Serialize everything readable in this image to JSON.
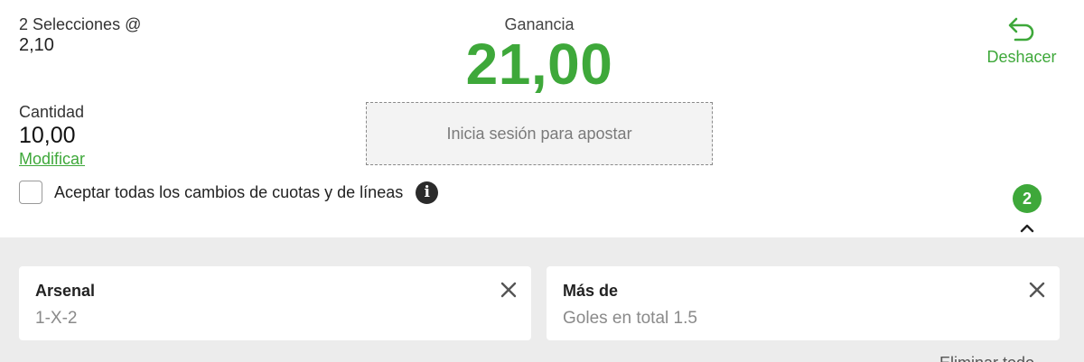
{
  "summary": {
    "selections_label": "2 Selecciones @",
    "odds": "2,10"
  },
  "gain": {
    "label": "Ganancia",
    "value": "21,00"
  },
  "undo": {
    "label": "Deshacer",
    "icon": "undo-icon"
  },
  "amount": {
    "label": "Cantidad",
    "value": "10,00",
    "modify_label": "Modificar"
  },
  "login_button": {
    "label": "Inicia sesión para apostar"
  },
  "accept_changes": {
    "label": "Aceptar todas los cambios de cuotas y de líneas",
    "checked": false,
    "info_icon": "info-icon",
    "info_glyph": "i"
  },
  "collapse": {
    "count": "2",
    "icon": "chevron-up-icon"
  },
  "selections": [
    {
      "title": "Arsenal",
      "market": "1-X-2"
    },
    {
      "title": "Más de",
      "market": "Goles en total 1.5"
    }
  ],
  "remove_all_label": "Eliminar todo",
  "colors": {
    "accent": "#3ea83a",
    "panel_bg": "#ececec",
    "text": "#222222",
    "muted": "#8a8a8a"
  }
}
